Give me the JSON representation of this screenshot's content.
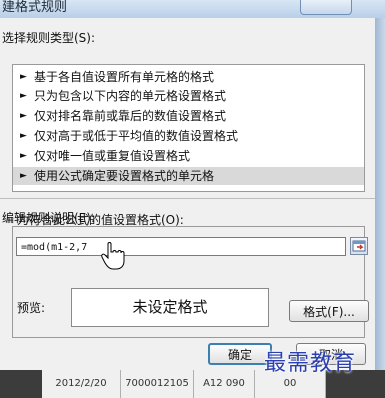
{
  "window": {
    "title": "建格式规则"
  },
  "rule_type": {
    "heading": "选择规则类型(S):",
    "items": [
      "基于各自值设置所有单元格的格式",
      "只为包含以下内容的单元格设置格式",
      "仅对排名靠前或靠后的数值设置格式",
      "仅对高于或低于平均值的数值设置格式",
      "仅对唯一值或重复值设置格式",
      "使用公式确定要设置格式的单元格"
    ],
    "selected_index": 5,
    "arrow_glyph": "►"
  },
  "description": {
    "heading": "编辑规则说明(E):",
    "formula_label": "为符合此公式的值设置格式(O):",
    "formula_value": "=mod(m1-2,7"
  },
  "preview": {
    "label": "预览:",
    "sample_text": "未设定格式",
    "format_button": "格式(F)..."
  },
  "buttons": {
    "ok": "确定",
    "cancel": "取消"
  },
  "sheet_row": {
    "date": "2012/2/20",
    "code": "7000012105",
    "col3": "A12 090",
    "col4": "00"
  },
  "watermark": "最需教育",
  "colors": {
    "dialog_bg": "#f0f0f0",
    "selected_row": "#d9d9d9",
    "ok_border": "#3c7fb1"
  }
}
